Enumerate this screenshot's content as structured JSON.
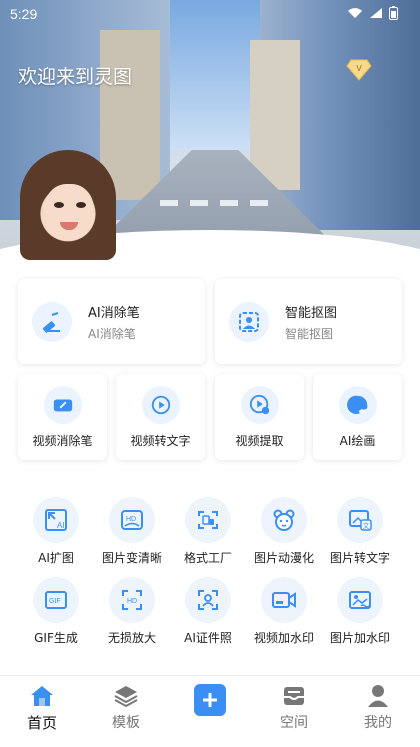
{
  "status": {
    "time": "5:29"
  },
  "header": {
    "welcome": "欢迎来到灵图",
    "vip_letter": "V"
  },
  "features_big": [
    {
      "title": "AI消除笔",
      "subtitle": "AI消除笔",
      "icon": "eraser-pen-icon"
    },
    {
      "title": "智能抠图",
      "subtitle": "智能抠图",
      "icon": "cutout-icon"
    }
  ],
  "features_small": [
    {
      "label": "视频消除笔",
      "icon": "video-eraser-icon"
    },
    {
      "label": "视频转文字",
      "icon": "video-to-text-icon"
    },
    {
      "label": "视频提取",
      "icon": "video-extract-icon"
    },
    {
      "label": "AI绘画",
      "icon": "palette-icon"
    }
  ],
  "tools": [
    {
      "label": "AI扩图",
      "icon": "expand-image-icon"
    },
    {
      "label": "图片变清晰",
      "icon": "hd-image-icon"
    },
    {
      "label": "格式工厂",
      "icon": "format-factory-icon"
    },
    {
      "label": "图片动漫化",
      "icon": "anime-bear-icon"
    },
    {
      "label": "图片转文字",
      "icon": "image-to-text-icon"
    },
    {
      "label": "GIF生成",
      "icon": "gif-icon"
    },
    {
      "label": "无损放大",
      "icon": "lossless-zoom-icon"
    },
    {
      "label": "AI证件照",
      "icon": "id-photo-icon"
    },
    {
      "label": "视频加水印",
      "icon": "video-watermark-icon"
    },
    {
      "label": "图片加水印",
      "icon": "image-watermark-icon"
    }
  ],
  "tool_icon_text": {
    "hd": "HD",
    "gif": "GIF",
    "ai": "AI",
    "wen": "文"
  },
  "nav": {
    "home": "首页",
    "templates": "模板",
    "space": "空间",
    "mine": "我的"
  },
  "colors": {
    "accent": "#3b8ff3",
    "icon_bg": "#eaf3ff"
  }
}
